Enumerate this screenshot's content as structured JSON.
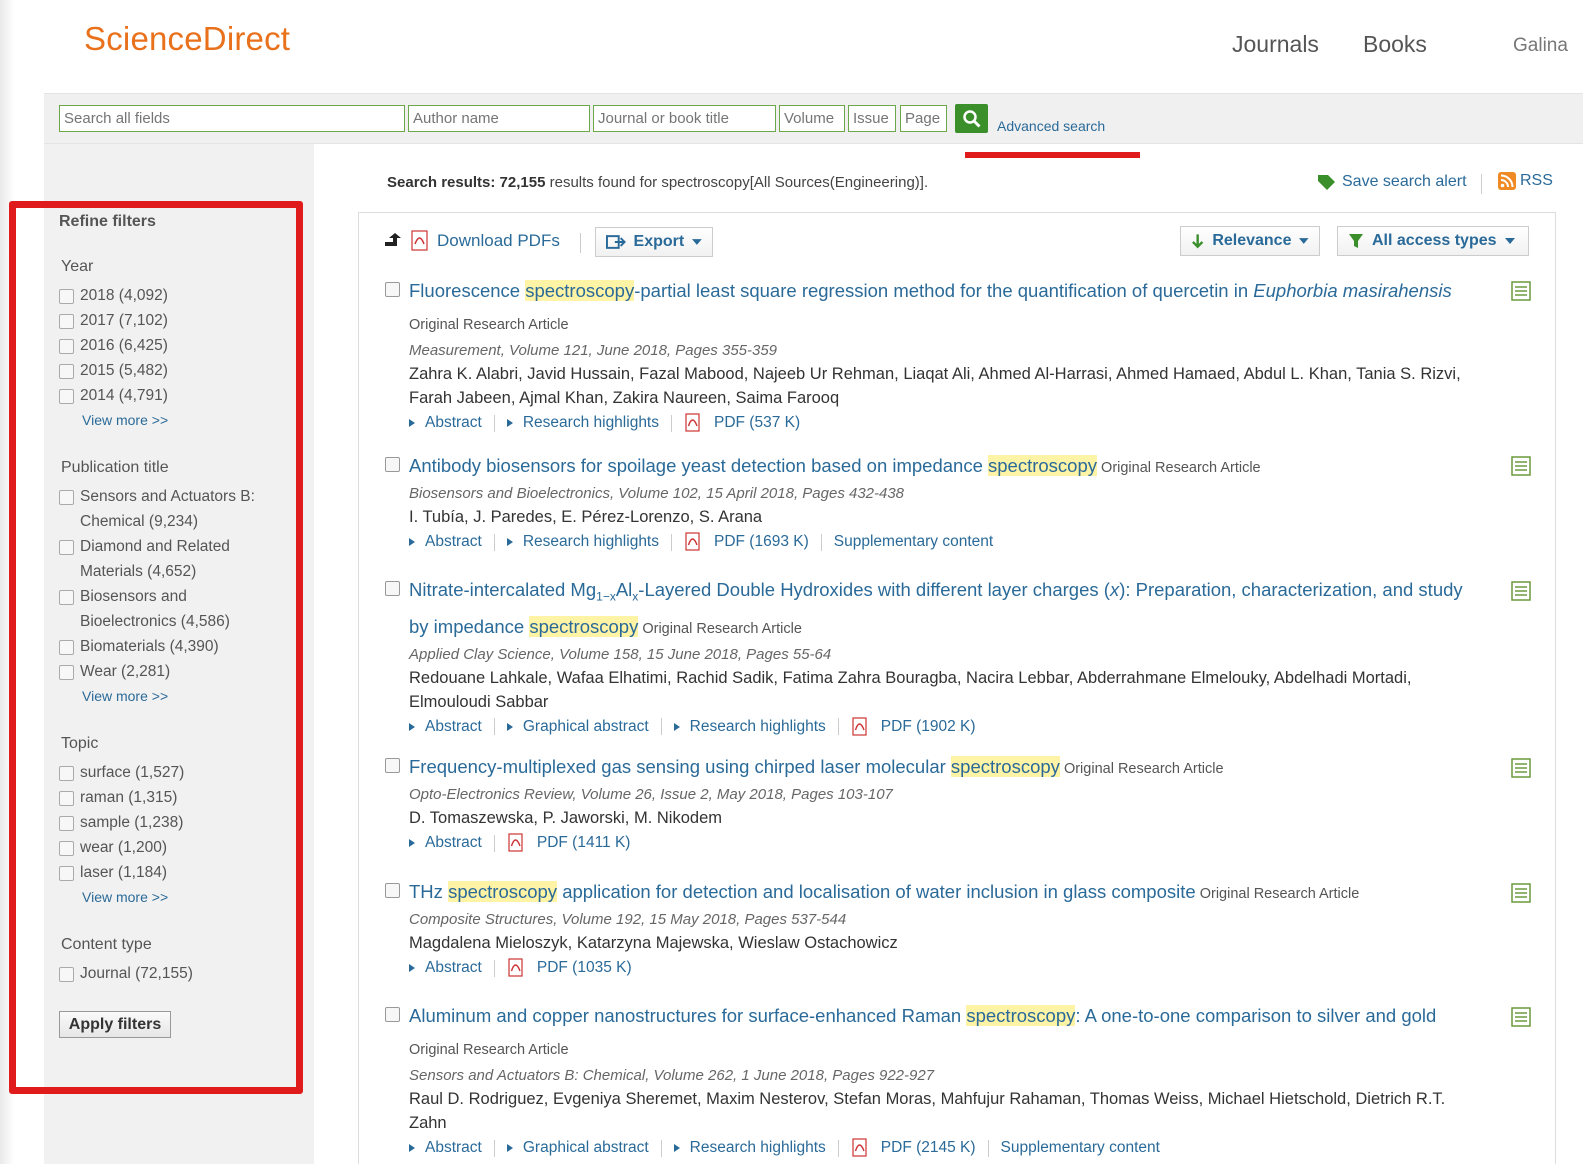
{
  "header": {
    "logo": "ScienceDirect",
    "nav": [
      "Journals",
      "Books",
      "Galina"
    ]
  },
  "search": {
    "all_fields_placeholder": "Search all fields",
    "author_placeholder": "Author name",
    "journal_placeholder": "Journal or book title",
    "volume_placeholder": "Volume",
    "issue_placeholder": "Issue",
    "page_placeholder": "Page",
    "advanced_label": "Advanced search"
  },
  "summary": {
    "prefix": "Search results: 72,155",
    "suffix": " results found for spectroscopy[All Sources(Engineering)].",
    "save_alert": "Save search alert",
    "rss": "RSS"
  },
  "sidebar": {
    "title": "Refine filters",
    "year_heading": "Year",
    "years": [
      {
        "label": "2018  (4,092)"
      },
      {
        "label": "2017  (7,102)"
      },
      {
        "label": "2016  (6,425)"
      },
      {
        "label": "2015  (5,482)"
      },
      {
        "label": "2014  (4,791)"
      }
    ],
    "view_more": "View more >>",
    "pub_heading": "Publication title",
    "pubs": [
      {
        "line1": "Sensors and Actuators B:",
        "line2": "Chemical  (9,234)"
      },
      {
        "line1": "Diamond and Related",
        "line2": "Materials  (4,652)"
      },
      {
        "line1": "Biosensors and",
        "line2": "Bioelectronics  (4,586)"
      },
      {
        "line1": "Biomaterials  (4,390)",
        "line2": ""
      },
      {
        "line1": "Wear  (2,281)",
        "line2": ""
      }
    ],
    "topic_heading": "Topic",
    "topics": [
      {
        "label": "surface  (1,527)"
      },
      {
        "label": "raman  (1,315)"
      },
      {
        "label": "sample  (1,238)"
      },
      {
        "label": "wear  (1,200)"
      },
      {
        "label": "laser  (1,184)"
      }
    ],
    "content_heading": "Content type",
    "content": [
      {
        "label": "Journal  (72,155)"
      }
    ],
    "apply": "Apply filters"
  },
  "toolbar": {
    "download": "Download PDFs",
    "export": "Export",
    "relevance": "Relevance",
    "access": "All access types"
  },
  "results": [
    {
      "t1": "Fluorescence ",
      "hl": "spectroscopy",
      "t2": "-partial least square regression method for the quantification of quercetin in ",
      "t2i": "Euphorbia masirahensis",
      "type": " Original Research Article",
      "source": "Measurement, Volume 121, June 2018, Pages 355-359",
      "authors": "Zahra K. Alabri, Javid Hussain, Fazal Mabood, Najeeb Ur Rehman, Liaqat Ali, Ahmed Al-Harrasi, Ahmed Hamaed, Abdul L. Khan, Tania S. Rizvi, Farah Jabeen, Ajmal Khan, Zakira Naureen, Saima Farooq",
      "links": [
        "Abstract",
        "Research highlights"
      ],
      "pdf": "PDF (537 K)",
      "extra": ""
    },
    {
      "t1": "Antibody biosensors for spoilage yeast detection based on impedance ",
      "hl": "spectroscopy",
      "t2": "",
      "t2i": "",
      "type": " Original Research Article",
      "source": "Biosensors and Bioelectronics, Volume 102, 15 April 2018, Pages 432-438",
      "authors": "I. Tubía, J. Paredes, E. Pérez-Lorenzo, S. Arana",
      "links": [
        "Abstract",
        "Research highlights"
      ],
      "pdf": "PDF (1693 K)",
      "extra": "Supplementary content"
    },
    {
      "t1": "Nitrate-intercalated Mg",
      "hl": "spectroscopy",
      "t2": "",
      "t2i": "",
      "type": " Original Research Article",
      "source": "Applied Clay Science, Volume 158, 15 June 2018, Pages 55-64",
      "authors": "Redouane Lahkale, Wafaa Elhatimi, Rachid Sadik, Fatima Zahra Bouragba, Nacira Lebbar, Abderrahmane Elmelouky, Abdelhadi Mortadi, Elmouloudi Sabbar",
      "links": [
        "Abstract",
        "Graphical abstract",
        "Research highlights"
      ],
      "pdf": "PDF (1902 K)",
      "extra": "",
      "mg_sub": "1−x",
      "al": "Al",
      "al_sub": "x",
      "t_mid": "-Layered Double Hydroxides with different layer charges (",
      "x": "x",
      "t_mid2": "): Preparation, characterization, and study by impedance "
    },
    {
      "t1": "Frequency-multiplexed gas sensing using chirped laser molecular ",
      "hl": "spectroscopy",
      "t2": "",
      "t2i": "",
      "type": " Original Research Article",
      "source": "Opto-Electronics Review, Volume 26, Issue 2, May 2018, Pages 103-107",
      "authors": "D. Tomaszewska, P. Jaworski, M. Nikodem",
      "links": [
        "Abstract"
      ],
      "pdf": "PDF (1411 K)",
      "extra": ""
    },
    {
      "t1": "THz ",
      "hl": "spectroscopy",
      "t2": " application for detection and localisation of water inclusion in glass composite",
      "t2i": "",
      "type": " Original Research Article",
      "source": "Composite Structures, Volume 192, 15 May 2018, Pages 537-544",
      "authors": "Magdalena Mieloszyk, Katarzyna Majewska, Wieslaw Ostachowicz",
      "links": [
        "Abstract"
      ],
      "pdf": "PDF (1035 K)",
      "extra": ""
    },
    {
      "t1": "Aluminum and copper nanostructures for surface-enhanced Raman ",
      "hl": "spectroscopy",
      "t2": ": A one-to-one comparison to silver and gold",
      "t2i": "",
      "type": " Original Research Article",
      "source": "Sensors and Actuators B: Chemical, Volume 262, 1 June 2018, Pages 922-927",
      "authors": "Raul D. Rodriguez, Evgeniya Sheremet, Maxim Nesterov, Stefan Moras, Mahfujur Rahaman, Thomas Weiss, Michael Hietschold, Dietrich R.T. Zahn",
      "links": [
        "Abstract",
        "Graphical abstract",
        "Research highlights"
      ],
      "pdf": "PDF (2145 K)",
      "extra": "Supplementary content"
    }
  ]
}
